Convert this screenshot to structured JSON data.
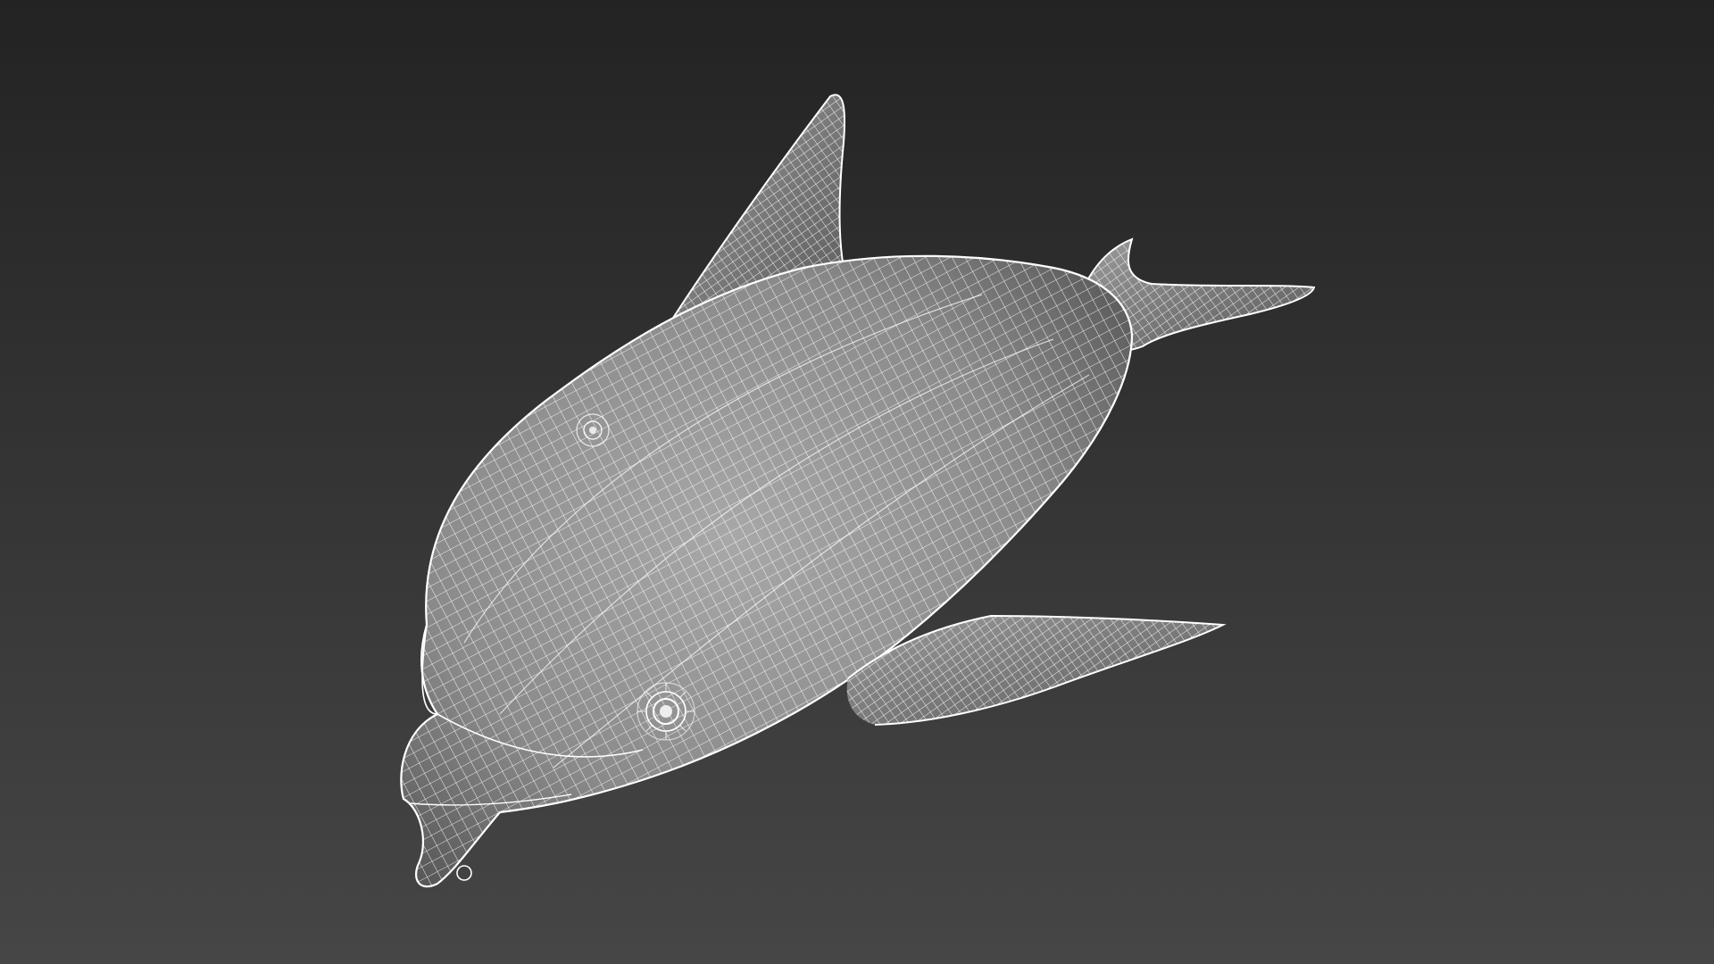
{
  "viewport": {
    "background_top_color": "#232323",
    "background_bottom_color": "#464646"
  },
  "model": {
    "subject": "dolphin",
    "display_mode": "wireframe",
    "wire_color": "#ffffff",
    "surface_light_color": "#a8a8a8",
    "surface_dark_color": "#4a4a4a",
    "parts": [
      "body",
      "dorsal-fin",
      "pectoral-fin",
      "tail-fluke",
      "eye",
      "blowhole",
      "beak"
    ]
  }
}
